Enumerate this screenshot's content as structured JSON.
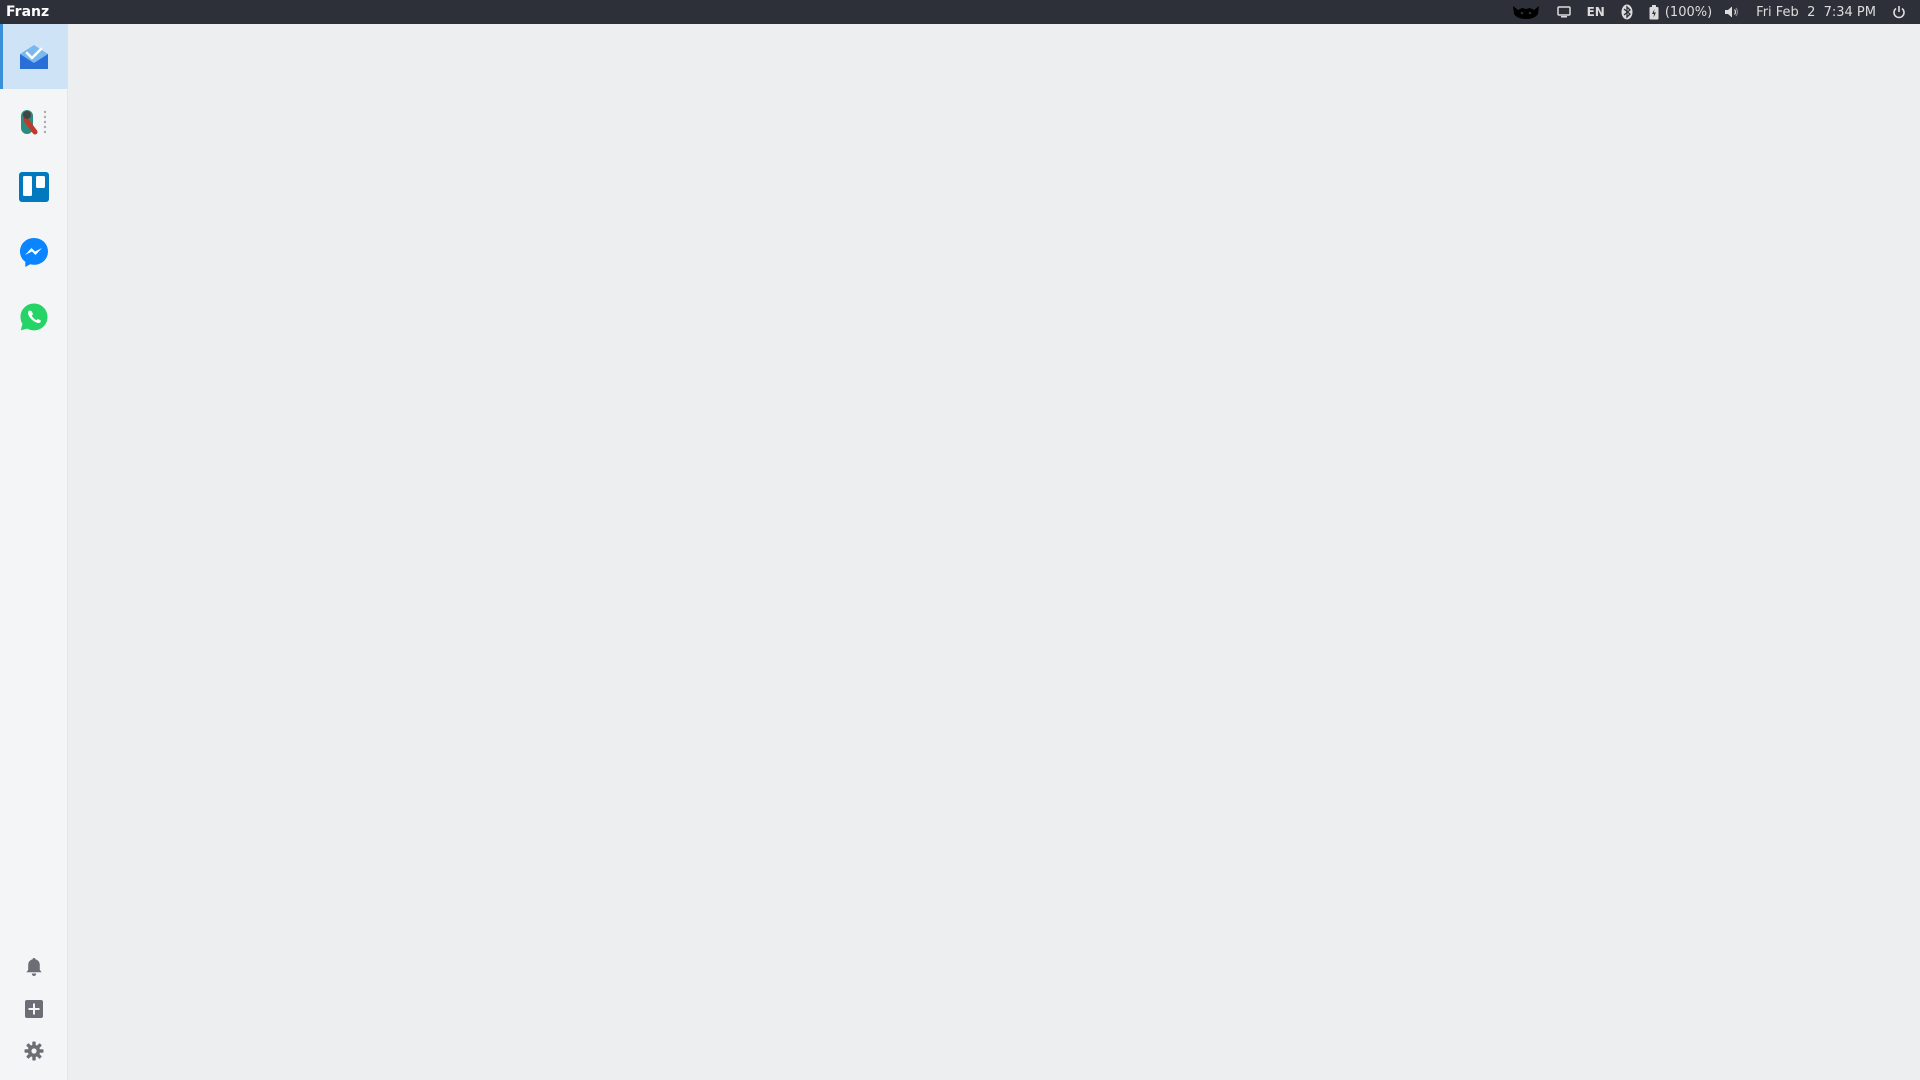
{
  "topbar": {
    "app_name": "Franz",
    "keyboard_layout": "EN",
    "battery_percent": "(100%)",
    "datetime": "Fri Feb  2  7:34 PM",
    "icons": [
      "cat-indicator-icon",
      "display-icon",
      "bluetooth-icon",
      "battery-icon",
      "volume-icon",
      "power-icon"
    ]
  },
  "sidebar": {
    "services": [
      {
        "icon": "inbox-mail-icon",
        "active": true,
        "color": "#3a7fe0"
      },
      {
        "icon": "rocket-chat-icon",
        "active": false,
        "color": "#c0392b"
      },
      {
        "icon": "trello-icon",
        "active": false,
        "color": "#0079bf"
      },
      {
        "icon": "messenger-icon",
        "active": false,
        "color": "#0084ff"
      },
      {
        "icon": "whatsapp-icon",
        "active": false,
        "color": "#25d366"
      }
    ],
    "tools": [
      "bell-icon",
      "add-service-icon",
      "gear-icon"
    ]
  },
  "colors": {
    "topbar_bg": "#2d3038",
    "sidebar_bg": "#f4f5f7",
    "active_service_bg": "#cfe3f7",
    "accent": "#3a8fd9",
    "content_bg": "#edeef0"
  }
}
